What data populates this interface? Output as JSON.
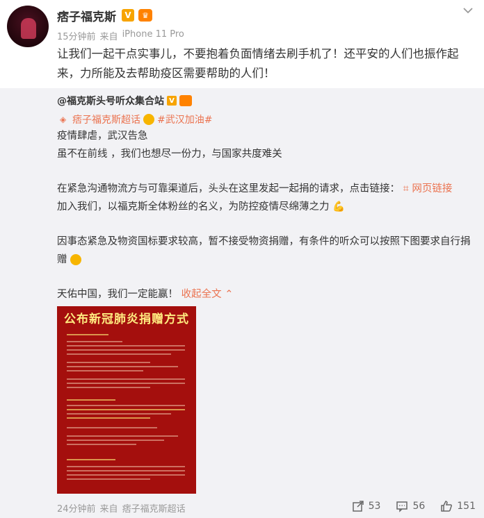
{
  "post": {
    "author": "痞子福克斯",
    "time": "15分钟前",
    "source_prefix": "来自",
    "source": "iPhone 11 Pro",
    "text": "让我们一起干点实事儿，不要抱着负面情绪去刷手机了！还平安的人们也振作起来，力所能及去帮助疫区需要帮助的人们！"
  },
  "repost": {
    "author": "@福克斯头号听众集合站",
    "tag_supertopic": "痞子福克斯超话",
    "tag_hashtag": "#武汉加油#",
    "line1": "疫情肆虐，武汉告急",
    "line2": "虽不在前线 ，我们也想尽一份力，与国家共度难关",
    "line3": "在紧急沟通物流方与可靠渠道后，头头在这里发起一起捐的请求，点击链接：",
    "link_label": "网页链接",
    "line4": "加入我们，以福克斯全体粉丝的名义，为防控疫情尽绵薄之力",
    "line5": "因事态紧急及物资国标要求较高，暂不接受物资捐赠，有条件的听众可以按照下图要求自行捐",
    "line6": "赠",
    "line7": "天佑中国，我们一定能赢！",
    "collapse_label": "收起全文",
    "poster_title": "公布新冠肺炎捐赠方式"
  },
  "footer": {
    "time": "24分钟前",
    "source_prefix": "来自",
    "source": "痞子福克斯超话",
    "shares": "53",
    "comments": "56",
    "likes": "151"
  },
  "colors": {
    "accent": "#eb7350",
    "repost_bg": "#f2f2f5",
    "poster_bg": "#a40f0d"
  }
}
